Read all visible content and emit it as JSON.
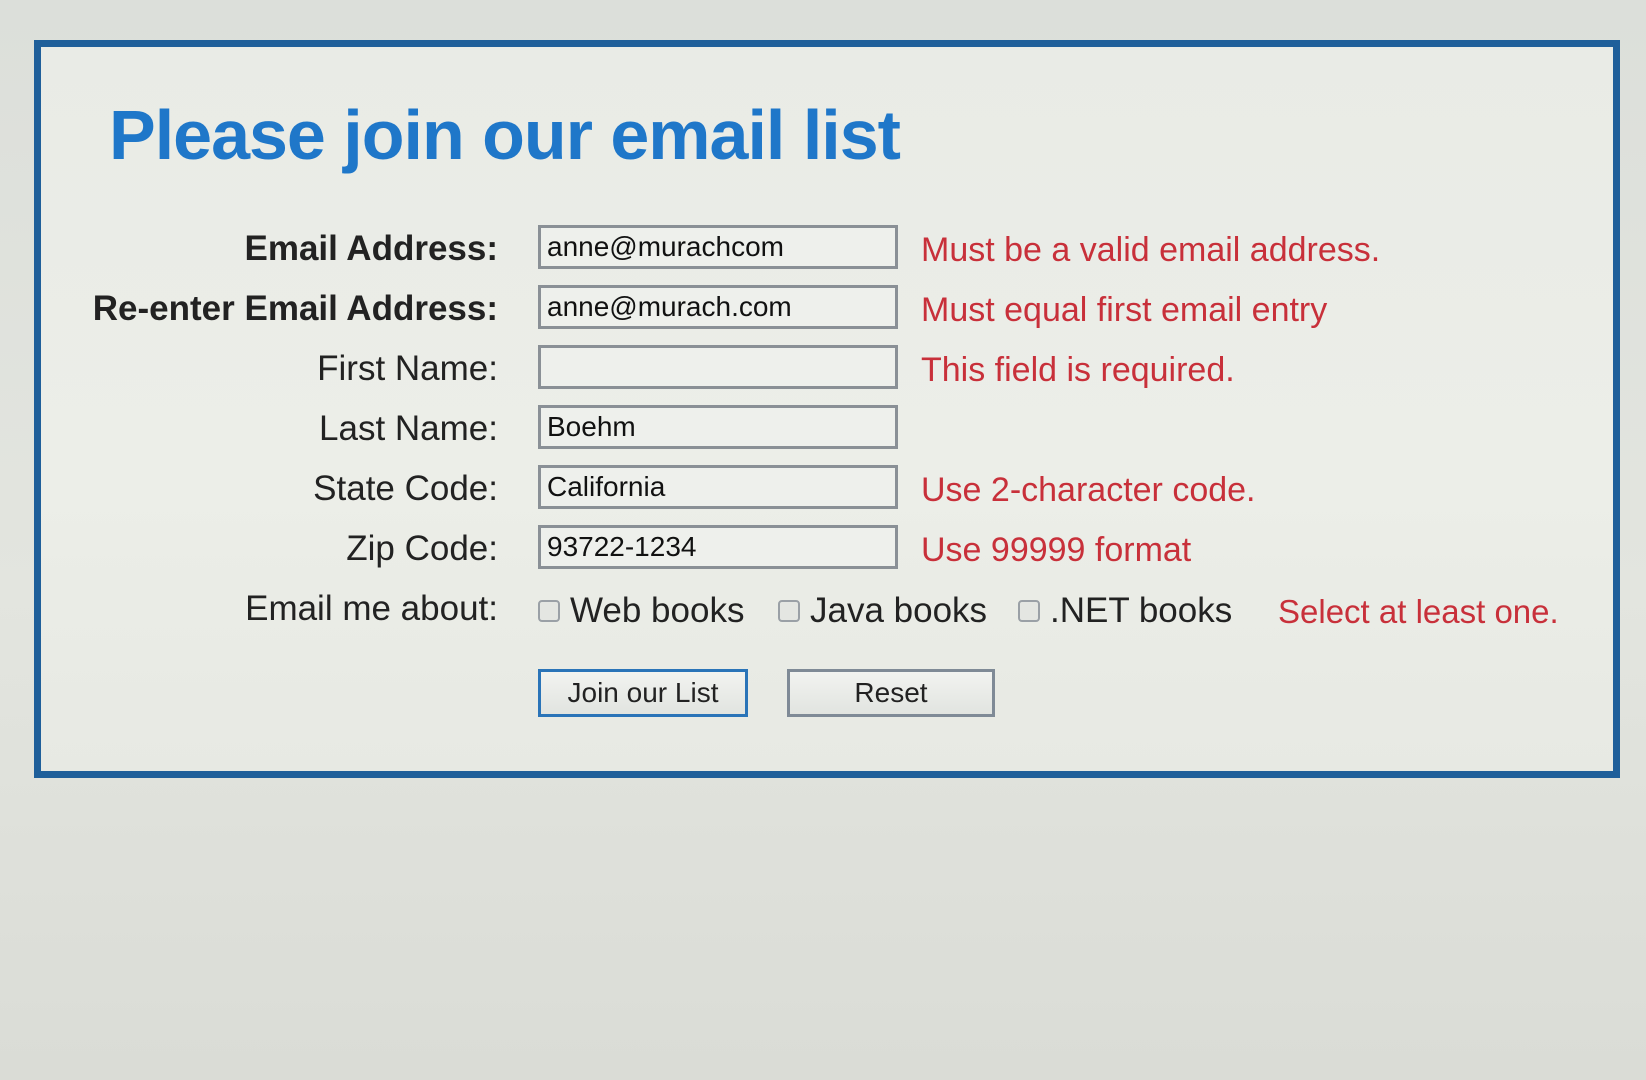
{
  "form": {
    "title": "Please join our email list",
    "fields": {
      "email": {
        "label": "Email Address:",
        "value": "anne@murachcom",
        "error": "Must be a valid email address."
      },
      "email2": {
        "label": "Re-enter Email Address:",
        "value": "anne@murach.com",
        "error": "Must equal first email entry"
      },
      "first_name": {
        "label": "First Name:",
        "value": "",
        "error": "This field is required."
      },
      "last_name": {
        "label": "Last Name:",
        "value": "Boehm",
        "error": ""
      },
      "state_code": {
        "label": "State Code:",
        "value": "California",
        "error": "Use 2-character code."
      },
      "zip_code": {
        "label": "Zip Code:",
        "value": "93722-1234",
        "error": "Use 99999 format"
      }
    },
    "email_me": {
      "label": "Email me about:",
      "options": [
        "Web books",
        "Java books",
        ".NET books"
      ],
      "error": "Select at least one."
    },
    "buttons": {
      "submit": "Join our List",
      "reset": "Reset"
    }
  },
  "colors": {
    "title": "#1f77c9",
    "border": "#1f5f9a",
    "error": "#c8303a"
  }
}
